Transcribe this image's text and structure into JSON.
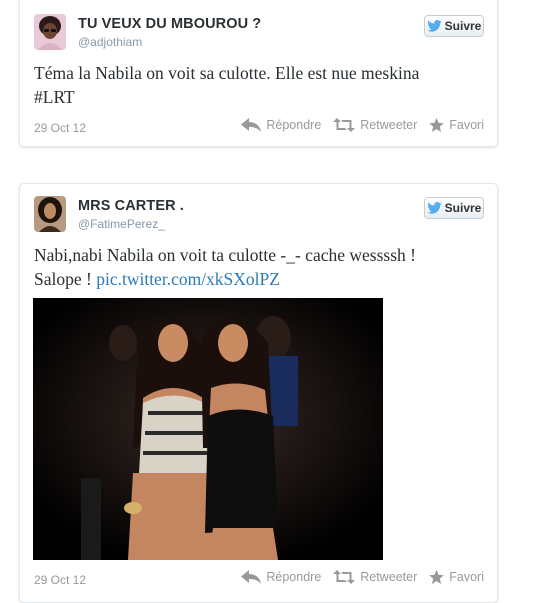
{
  "tweets": [
    {
      "display_name": "TU VEUX DU MBOUROU ?",
      "handle": "@adjothiam",
      "follow_label": "Suivre",
      "text_parts": [
        "Téma la Nabila on voit sa culotte. Elle est nue meskina\n#LRT"
      ],
      "date": "29 Oct 12",
      "actions": {
        "reply": "Répondre",
        "retweet": "Retweeter",
        "favorite": "Favori"
      }
    },
    {
      "display_name": "MRS CARTER .",
      "handle": "@FatimePerez_",
      "follow_label": "Suivre",
      "text_before_link": "Nabi,nabi Nabila on voit ta culotte -_- cache wessssh !\nSalope ! ",
      "link_text": "pic.twitter.com/xkSXolPZ",
      "date": "29 Oct 12",
      "actions": {
        "reply": "Répondre",
        "retweet": "Retweeter",
        "favorite": "Favori"
      }
    }
  ],
  "colors": {
    "twitter_blue": "#55acee",
    "link": "#2b7bb9",
    "meta_grey": "#999999"
  },
  "icons": [
    "twitter-bird-icon",
    "reply-icon",
    "retweet-icon",
    "star-icon"
  ]
}
